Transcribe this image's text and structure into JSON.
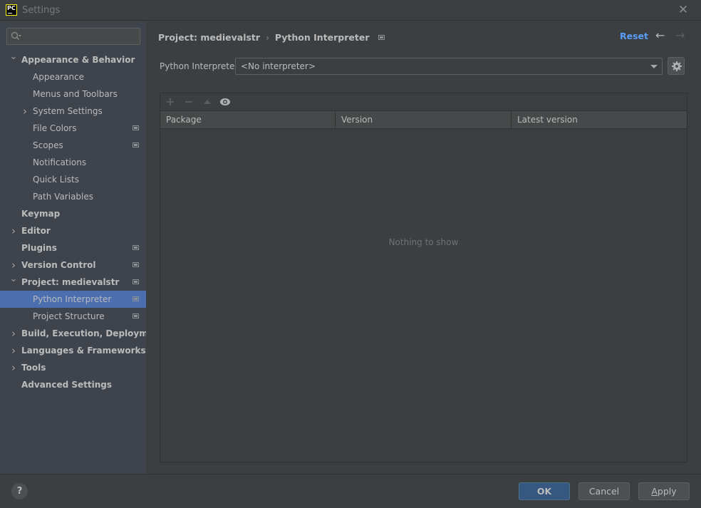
{
  "window": {
    "title": "Settings",
    "app_logo": "PC",
    "close_icon": "close-icon"
  },
  "sidebar": {
    "search": {
      "value": "",
      "placeholder": ""
    },
    "items": [
      {
        "label": "Appearance & Behavior",
        "level": 0,
        "arrow": "expanded",
        "bold": true,
        "project_icon": false,
        "selected": false
      },
      {
        "label": "Appearance",
        "level": 1,
        "arrow": "none",
        "project_icon": false,
        "selected": false
      },
      {
        "label": "Menus and Toolbars",
        "level": 1,
        "arrow": "none",
        "project_icon": false,
        "selected": false
      },
      {
        "label": "System Settings",
        "level": 1,
        "arrow": "collapsed",
        "project_icon": false,
        "selected": false
      },
      {
        "label": "File Colors",
        "level": 1,
        "arrow": "none",
        "project_icon": true,
        "selected": false
      },
      {
        "label": "Scopes",
        "level": 1,
        "arrow": "none",
        "project_icon": true,
        "selected": false
      },
      {
        "label": "Notifications",
        "level": 1,
        "arrow": "none",
        "project_icon": false,
        "selected": false
      },
      {
        "label": "Quick Lists",
        "level": 1,
        "arrow": "none",
        "project_icon": false,
        "selected": false
      },
      {
        "label": "Path Variables",
        "level": 1,
        "arrow": "none",
        "project_icon": false,
        "selected": false
      },
      {
        "label": "Keymap",
        "level": 0,
        "arrow": "none",
        "project_icon": false,
        "selected": false
      },
      {
        "label": "Editor",
        "level": 0,
        "arrow": "collapsed",
        "project_icon": false,
        "selected": false
      },
      {
        "label": "Plugins",
        "level": 0,
        "arrow": "none",
        "project_icon": true,
        "selected": false
      },
      {
        "label": "Version Control",
        "level": 0,
        "arrow": "collapsed",
        "project_icon": true,
        "selected": false
      },
      {
        "label": "Project: medievalstr",
        "level": 0,
        "arrow": "expanded",
        "project_icon": true,
        "selected": false
      },
      {
        "label": "Python Interpreter",
        "level": 1,
        "arrow": "none",
        "project_icon": true,
        "selected": true
      },
      {
        "label": "Project Structure",
        "level": 1,
        "arrow": "none",
        "project_icon": true,
        "selected": false
      },
      {
        "label": "Build, Execution, Deployment",
        "level": 0,
        "arrow": "collapsed",
        "project_icon": false,
        "selected": false
      },
      {
        "label": "Languages & Frameworks",
        "level": 0,
        "arrow": "collapsed",
        "project_icon": false,
        "selected": false
      },
      {
        "label": "Tools",
        "level": 0,
        "arrow": "collapsed",
        "project_icon": false,
        "selected": false
      },
      {
        "label": "Advanced Settings",
        "level": 0,
        "arrow": "none",
        "project_icon": false,
        "selected": false
      }
    ]
  },
  "content": {
    "breadcrumb": {
      "parent": "Project: medievalstr",
      "separator": "›",
      "current": "Python Interpreter"
    },
    "reset_label": "Reset",
    "back_arrow": "←",
    "forward_arrow": "→",
    "interpreter": {
      "label": "Python Interpreter:",
      "value": "<No interpreter>"
    },
    "toolbar": {
      "add": "+",
      "remove": "−"
    },
    "table": {
      "columns": [
        "Package",
        "Version",
        "Latest version"
      ],
      "rows": [],
      "empty_text": "Nothing to show"
    }
  },
  "footer": {
    "help": "?",
    "ok_label": "OK",
    "cancel_label": "Cancel",
    "apply_mnemonic": "A",
    "apply_rest": "pply"
  },
  "colors": {
    "accent_link": "#589df6",
    "selection": "#4b6eaf",
    "ok_button": "#365880"
  }
}
